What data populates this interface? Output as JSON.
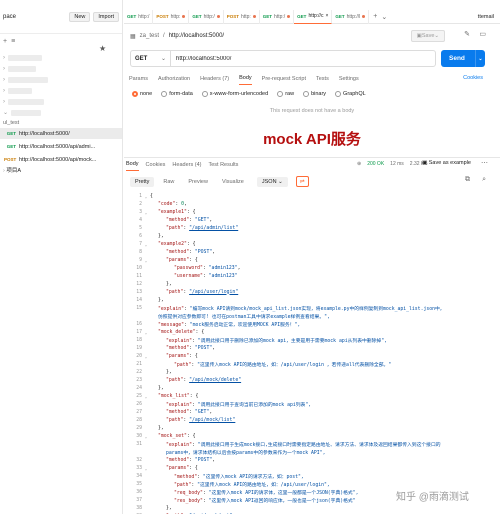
{
  "sidebar": {
    "workspace": "pace",
    "new_label": "New",
    "import_label": "Import",
    "group_label": "ul_test",
    "requests": [
      {
        "method": "GET",
        "url": "http://localhost:5000/",
        "active": true
      },
      {
        "method": "GET",
        "url": "http://localhost:5000/api/admi..."
      },
      {
        "method": "POST",
        "url": "http://localhost:5000/api/mock..."
      }
    ],
    "folder": "项目A"
  },
  "tabs": [
    {
      "method": "GET",
      "label": "http:/",
      "dot": false
    },
    {
      "method": "POST",
      "label": "http:",
      "dot": true
    },
    {
      "method": "GET",
      "label": "http:/",
      "dot": true
    },
    {
      "method": "POST",
      "label": "http:",
      "dot": true
    },
    {
      "method": "GET",
      "label": "http:/",
      "dot": true
    },
    {
      "method": "GET",
      "label": "http://c",
      "dot": false,
      "active": true
    },
    {
      "method": "GET",
      "label": "http://l",
      "dot": true
    }
  ],
  "environment": "ttemail",
  "request": {
    "breadcrumb": "za_test",
    "title": "http://localhost:5000/",
    "save_label": "Save",
    "method": "GET",
    "url": "http://localhost:5000/",
    "send_label": "Send",
    "tabs": [
      "Params",
      "Authorization",
      "Headers (7)",
      "Body",
      "Pre-request Script",
      "Tests",
      "Settings"
    ],
    "cookies_label": "Cookies",
    "body_types": [
      "none",
      "form-data",
      "x-www-form-urlencoded",
      "raw",
      "binary",
      "GraphQL"
    ],
    "no_body_msg": "This request does not have a body"
  },
  "overlay_title": "mock API服务",
  "response": {
    "tabs": [
      "Body",
      "Cookies",
      "Headers (4)",
      "Test Results"
    ],
    "status": "200 OK",
    "time": "12 ms",
    "size": "2.32 KB",
    "save_label": "Save as example",
    "views": [
      "Pretty",
      "Raw",
      "Preview",
      "Visualize"
    ],
    "format": "JSON"
  },
  "code_lines": [
    {
      "ln": 1,
      "fold": "⌄",
      "ind": 0,
      "parts": [
        {
          "t": "{",
          "c": "ct"
        }
      ]
    },
    {
      "ln": 2,
      "ind": 1,
      "parts": [
        {
          "t": "\"code\"",
          "c": "k"
        },
        {
          "t": ": ",
          "c": "ct"
        },
        {
          "t": "0",
          "c": "n"
        },
        {
          "t": ",",
          "c": "ct"
        }
      ]
    },
    {
      "ln": 3,
      "fold": "⌄",
      "ind": 1,
      "parts": [
        {
          "t": "\"example1\"",
          "c": "k"
        },
        {
          "t": ": {",
          "c": "ct"
        }
      ]
    },
    {
      "ln": 4,
      "ind": 2,
      "parts": [
        {
          "t": "\"method\"",
          "c": "k"
        },
        {
          "t": ": ",
          "c": "ct"
        },
        {
          "t": "\"GET\"",
          "c": "s"
        },
        {
          "t": ",",
          "c": "ct"
        }
      ]
    },
    {
      "ln": 5,
      "ind": 2,
      "parts": [
        {
          "t": "\"path\"",
          "c": "k"
        },
        {
          "t": ": ",
          "c": "ct"
        },
        {
          "t": "\"/api/admin/list\"",
          "c": "s ul"
        }
      ]
    },
    {
      "ln": 6,
      "ind": 1,
      "parts": [
        {
          "t": "},",
          "c": "ct"
        }
      ]
    },
    {
      "ln": 7,
      "fold": "⌄",
      "ind": 1,
      "parts": [
        {
          "t": "\"example2\"",
          "c": "k"
        },
        {
          "t": ": {",
          "c": "ct"
        }
      ]
    },
    {
      "ln": 8,
      "ind": 2,
      "parts": [
        {
          "t": "\"method\"",
          "c": "k"
        },
        {
          "t": ": ",
          "c": "ct"
        },
        {
          "t": "\"POST\"",
          "c": "s"
        },
        {
          "t": ",",
          "c": "ct"
        }
      ]
    },
    {
      "ln": 9,
      "fold": "⌄",
      "ind": 2,
      "parts": [
        {
          "t": "\"params\"",
          "c": "k"
        },
        {
          "t": ": {",
          "c": "ct"
        }
      ]
    },
    {
      "ln": 10,
      "ind": 3,
      "parts": [
        {
          "t": "\"password\"",
          "c": "k"
        },
        {
          "t": ": ",
          "c": "ct"
        },
        {
          "t": "\"admin123\"",
          "c": "s"
        },
        {
          "t": ",",
          "c": "ct"
        }
      ]
    },
    {
      "ln": 11,
      "ind": 3,
      "parts": [
        {
          "t": "\"username\"",
          "c": "k"
        },
        {
          "t": ": ",
          "c": "ct"
        },
        {
          "t": "\"admin123\"",
          "c": "s"
        }
      ]
    },
    {
      "ln": 12,
      "ind": 2,
      "parts": [
        {
          "t": "},",
          "c": "ct"
        }
      ]
    },
    {
      "ln": 13,
      "ind": 2,
      "parts": [
        {
          "t": "\"path\"",
          "c": "k"
        },
        {
          "t": ": ",
          "c": "ct"
        },
        {
          "t": "\"/api/user/login\"",
          "c": "s ul"
        }
      ]
    },
    {
      "ln": 14,
      "ind": 1,
      "parts": [
        {
          "t": "},",
          "c": "ct"
        }
      ]
    },
    {
      "ln": 15,
      "ind": 1,
      "parts": [
        {
          "t": "\"explain\"",
          "c": "k"
        },
        {
          "t": ": ",
          "c": "ct"
        },
        {
          "t": "\"编写mock API请到mock/mock_api_list.json实现，将example.py中的样例复制到mock_api_list.json中，",
          "c": "s"
        }
      ]
    },
    {
      "ln": "",
      "ind": 1,
      "parts": [
        {
          "t": "仿照提供对应参数即可! 也可在postman工具中请求example样例查看结果。\",",
          "c": "s"
        }
      ]
    },
    {
      "ln": 16,
      "ind": 1,
      "parts": [
        {
          "t": "\"message\"",
          "c": "k"
        },
        {
          "t": ": ",
          "c": "ct"
        },
        {
          "t": "\"mock服务启动正常，欢迎使用MOCK API服务！\",",
          "c": "s"
        }
      ]
    },
    {
      "ln": 17,
      "fold": "⌄",
      "ind": 1,
      "parts": [
        {
          "t": "\"mock_delete\"",
          "c": "k"
        },
        {
          "t": ": {",
          "c": "ct"
        }
      ]
    },
    {
      "ln": 18,
      "ind": 2,
      "parts": [
        {
          "t": "\"explain\"",
          "c": "k"
        },
        {
          "t": ": ",
          "c": "ct"
        },
        {
          "t": "\"调用此接口用于删除已添加的mock api，主要是用于需要mock api从列表中删除掉\",",
          "c": "s"
        }
      ]
    },
    {
      "ln": 19,
      "ind": 2,
      "parts": [
        {
          "t": "\"method\"",
          "c": "k"
        },
        {
          "t": ": ",
          "c": "ct"
        },
        {
          "t": "\"POST\"",
          "c": "s"
        },
        {
          "t": ",",
          "c": "ct"
        }
      ]
    },
    {
      "ln": 20,
      "fold": "⌄",
      "ind": 2,
      "parts": [
        {
          "t": "\"params\"",
          "c": "k"
        },
        {
          "t": ": {",
          "c": "ct"
        }
      ]
    },
    {
      "ln": 21,
      "ind": 3,
      "parts": [
        {
          "t": "\"path\"",
          "c": "k"
        },
        {
          "t": ": ",
          "c": "ct"
        },
        {
          "t": "\"这里传入mock API的路由地址，如：/api/user/login ，若传递all代表删除全部。\"",
          "c": "s"
        }
      ]
    },
    {
      "ln": 22,
      "ind": 2,
      "parts": [
        {
          "t": "},",
          "c": "ct"
        }
      ]
    },
    {
      "ln": 23,
      "ind": 2,
      "parts": [
        {
          "t": "\"path\"",
          "c": "k"
        },
        {
          "t": ": ",
          "c": "ct"
        },
        {
          "t": "\"/api/mock/delete\"",
          "c": "s ul"
        }
      ]
    },
    {
      "ln": 24,
      "ind": 1,
      "parts": [
        {
          "t": "},",
          "c": "ct"
        }
      ]
    },
    {
      "ln": 25,
      "fold": "⌄",
      "ind": 1,
      "parts": [
        {
          "t": "\"mock_list\"",
          "c": "k"
        },
        {
          "t": ": {",
          "c": "ct"
        }
      ]
    },
    {
      "ln": 26,
      "ind": 2,
      "parts": [
        {
          "t": "\"explain\"",
          "c": "k"
        },
        {
          "t": ": ",
          "c": "ct"
        },
        {
          "t": "\"调用此接口用于查询当前已添加的mock api列表\",",
          "c": "s"
        }
      ]
    },
    {
      "ln": 27,
      "ind": 2,
      "parts": [
        {
          "t": "\"method\"",
          "c": "k"
        },
        {
          "t": ": ",
          "c": "ct"
        },
        {
          "t": "\"GET\"",
          "c": "s"
        },
        {
          "t": ",",
          "c": "ct"
        }
      ]
    },
    {
      "ln": 28,
      "ind": 2,
      "parts": [
        {
          "t": "\"path\"",
          "c": "k"
        },
        {
          "t": ": ",
          "c": "ct"
        },
        {
          "t": "\"/api/mock/list\"",
          "c": "s ul"
        }
      ]
    },
    {
      "ln": 29,
      "ind": 1,
      "parts": [
        {
          "t": "},",
          "c": "ct"
        }
      ]
    },
    {
      "ln": 30,
      "fold": "⌄",
      "ind": 1,
      "parts": [
        {
          "t": "\"mock_set\"",
          "c": "k"
        },
        {
          "t": ": {",
          "c": "ct"
        }
      ]
    },
    {
      "ln": 31,
      "ind": 2,
      "parts": [
        {
          "t": "\"explain\"",
          "c": "k"
        },
        {
          "t": ": ",
          "c": "ct"
        },
        {
          "t": "\"调用此接口用于生成mock接口,生成接口时需要指定路由地址、请求方法、请求体及返回结果都传入到这个接口的",
          "c": "s"
        }
      ]
    },
    {
      "ln": "",
      "ind": 2,
      "parts": [
        {
          "t": "params中，请求体结构以后会按params中的参数来作为一个mock API\",",
          "c": "s"
        }
      ]
    },
    {
      "ln": 32,
      "ind": 2,
      "parts": [
        {
          "t": "\"method\"",
          "c": "k"
        },
        {
          "t": ": ",
          "c": "ct"
        },
        {
          "t": "\"POST\"",
          "c": "s"
        },
        {
          "t": ",",
          "c": "ct"
        }
      ]
    },
    {
      "ln": 33,
      "fold": "⌄",
      "ind": 2,
      "parts": [
        {
          "t": "\"params\"",
          "c": "k"
        },
        {
          "t": ": {",
          "c": "ct"
        }
      ]
    },
    {
      "ln": 34,
      "ind": 3,
      "parts": [
        {
          "t": "\"method\"",
          "c": "k"
        },
        {
          "t": ": ",
          "c": "ct"
        },
        {
          "t": "\"这里传入mock API的请求方法，如：post\",",
          "c": "s"
        }
      ]
    },
    {
      "ln": 35,
      "ind": 3,
      "parts": [
        {
          "t": "\"path\"",
          "c": "k"
        },
        {
          "t": ": ",
          "c": "ct"
        },
        {
          "t": "\"这里传入mock API的路由地址，如：/api/user/login\",",
          "c": "s"
        }
      ]
    },
    {
      "ln": 36,
      "ind": 3,
      "parts": [
        {
          "t": "\"req_body\"",
          "c": "k"
        },
        {
          "t": ": ",
          "c": "ct"
        },
        {
          "t": "\"这里传入mock API的请求体，这里一般都是一个JSON(字典)格式\",",
          "c": "s"
        }
      ]
    },
    {
      "ln": 37,
      "ind": 3,
      "parts": [
        {
          "t": "\"res_body\"",
          "c": "k"
        },
        {
          "t": ": ",
          "c": "ct"
        },
        {
          "t": "\"这里传入mock API返回的响应体，一般也是一个json(字典)格式\"",
          "c": "s"
        }
      ]
    },
    {
      "ln": 38,
      "ind": 2,
      "parts": [
        {
          "t": "},",
          "c": "ct"
        }
      ]
    },
    {
      "ln": 39,
      "ind": 2,
      "parts": [
        {
          "t": "\"path\"",
          "c": "k"
        },
        {
          "t": ": ",
          "c": "ct"
        },
        {
          "t": "\"/api/mock/set\"",
          "c": "s ul"
        }
      ]
    },
    {
      "ln": 40,
      "ind": 1,
      "parts": [
        {
          "t": "}",
          "c": "ct"
        }
      ]
    }
  ],
  "watermark": "知乎 @雨滴测试"
}
